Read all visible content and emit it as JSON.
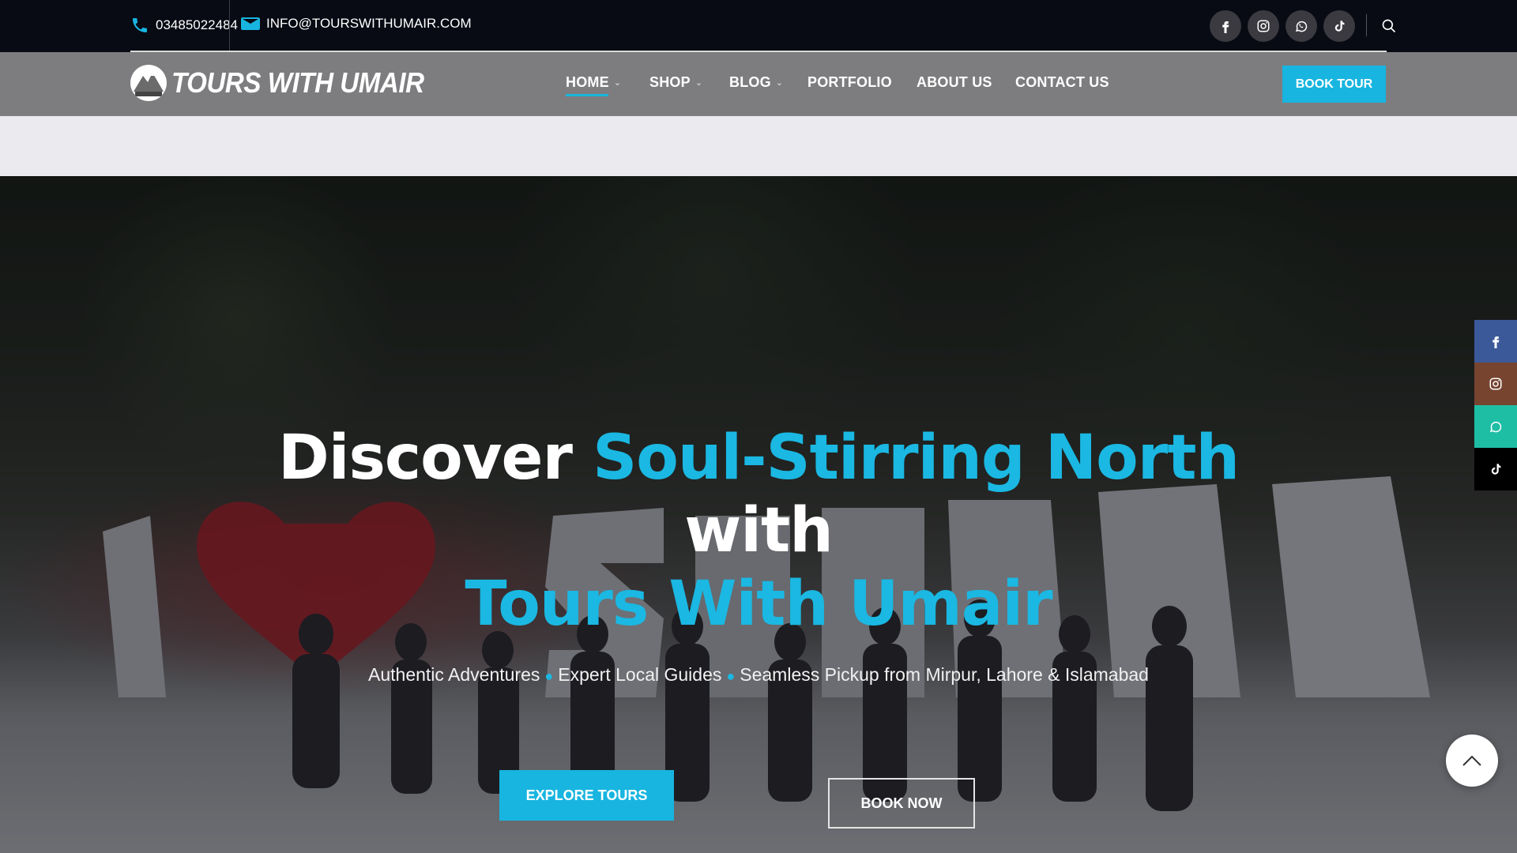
{
  "topbar": {
    "phone": "03485022484",
    "email": "INFO@TOURSWITHUMAIR.COM",
    "social_icons": [
      "facebook-icon",
      "instagram-icon",
      "whatsapp-icon",
      "tiktok-icon"
    ],
    "search_icon": "search-icon"
  },
  "nav": {
    "logo_text": "TOURS WITH UMAIR",
    "items": [
      {
        "label": "HOME",
        "has_dropdown": true,
        "active": true
      },
      {
        "label": "SHOP",
        "has_dropdown": true
      },
      {
        "label": "BLOG",
        "has_dropdown": true
      },
      {
        "label": "PORTFOLIO"
      },
      {
        "label": "ABOUT US"
      },
      {
        "label": "CONTACT US"
      }
    ],
    "book_tour_label": "BOOK TOUR"
  },
  "hero": {
    "line1_white": "Discover",
    "line1_accent": "Soul-Stirring North",
    "line2": "with",
    "line3": "Tours With Umair",
    "subtitle_parts": [
      "Authentic Adventures",
      "Expert Local Guides",
      "Seamless Pickup from Mirpur, Lahore & Islamabad"
    ],
    "explore_label": "EXPLORE TOURS",
    "book_now_label": "BOOK NOW"
  },
  "side_social": [
    {
      "icon": "facebook-icon",
      "color": "#3b5998"
    },
    {
      "icon": "instagram-icon",
      "color": "#774430"
    },
    {
      "icon": "whatsapp-icon",
      "color": "#1ebea5"
    },
    {
      "icon": "tiktok-icon",
      "color": "#000000"
    }
  ],
  "colors": {
    "accent": "#18b5e0",
    "topbar": "#080a14",
    "navbar": "#7d7d80"
  }
}
